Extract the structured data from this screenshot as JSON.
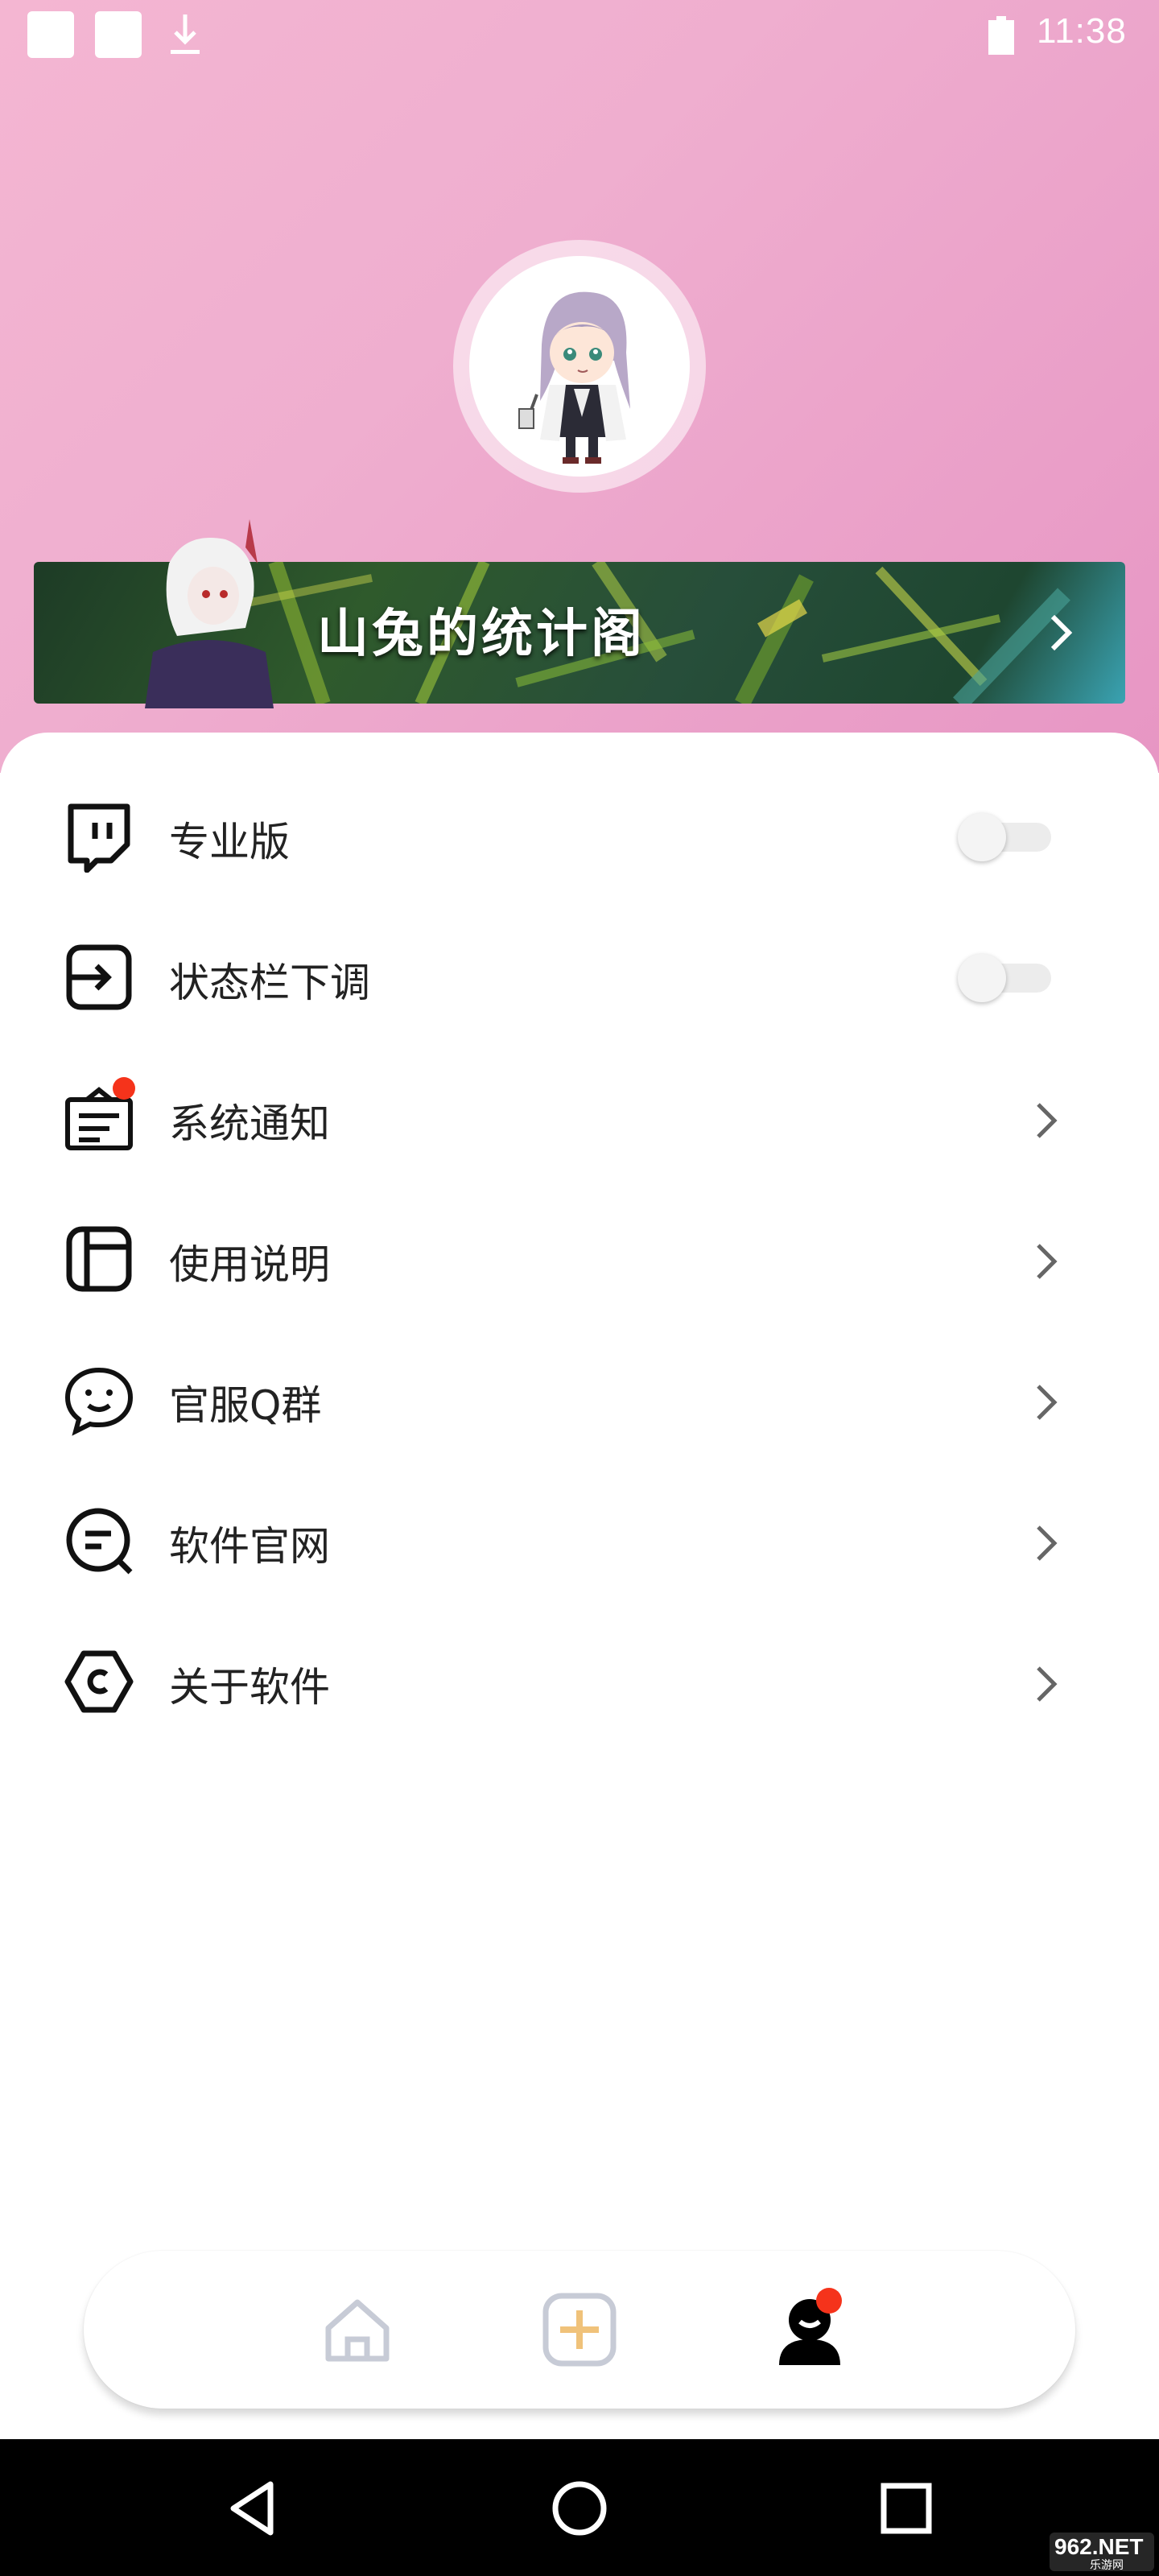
{
  "status_bar": {
    "time": "11:38",
    "icons": [
      "square-notification-icon",
      "square-notification-icon",
      "download-icon",
      "battery-icon"
    ]
  },
  "profile": {
    "avatar_icon": "chibi-character-avatar"
  },
  "banner": {
    "title": "山兔的统计阁",
    "arrow_icon": "chevron-right-icon"
  },
  "menu": {
    "items": [
      {
        "label": "专业版",
        "icon": "twitch-icon",
        "control": "toggle",
        "on": false
      },
      {
        "label": "状态栏下调",
        "icon": "enter-square-icon",
        "control": "toggle",
        "on": false
      },
      {
        "label": "系统通知",
        "icon": "notification-box-icon",
        "control": "chevron",
        "has_badge": true
      },
      {
        "label": "使用说明",
        "icon": "notebook-icon",
        "control": "chevron"
      },
      {
        "label": "官服Q群",
        "icon": "chat-smile-icon",
        "control": "chevron"
      },
      {
        "label": "软件官网",
        "icon": "chat-search-icon",
        "control": "chevron"
      },
      {
        "label": "关于软件",
        "icon": "hexagon-icon",
        "control": "chevron"
      }
    ]
  },
  "bottom_nav": {
    "items": [
      "home-icon",
      "add-icon",
      "profile-icon"
    ],
    "active": "profile-icon",
    "accent_color": "#f0c27a",
    "badge_color": "#f5331b"
  },
  "system_nav": {
    "items": [
      "back-icon",
      "home-circle-icon",
      "recents-icon"
    ]
  },
  "watermark": {
    "text": "962.NET",
    "subtext": "乐游网"
  }
}
